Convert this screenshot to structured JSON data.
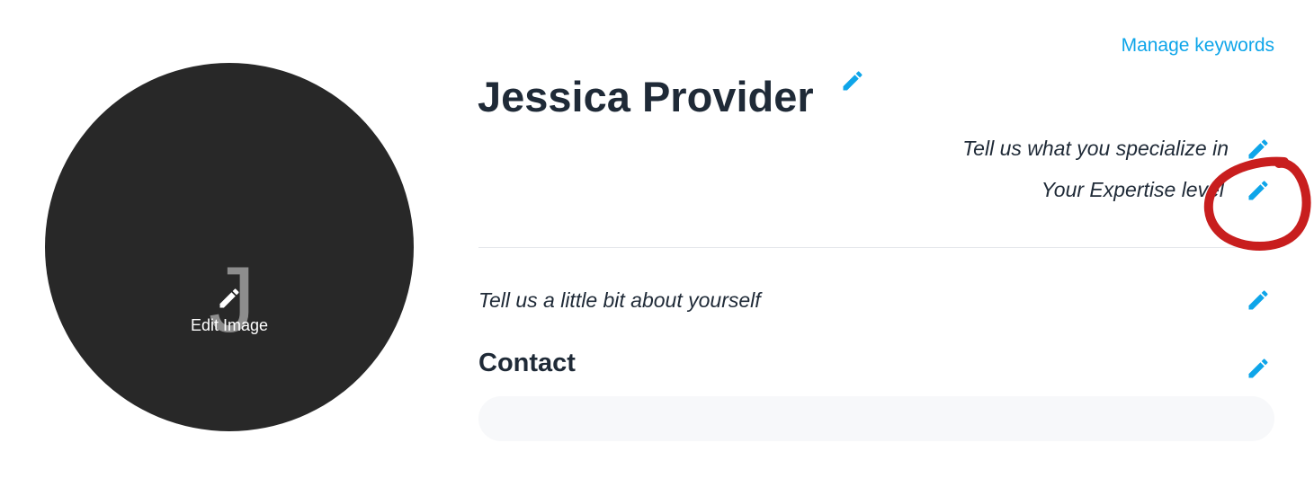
{
  "avatar": {
    "initial": "J",
    "edit_label": "Edit Image"
  },
  "header": {
    "manage_keywords": "Manage keywords",
    "name": "Jessica Provider"
  },
  "fields": {
    "specialize_placeholder": "Tell us what you specialize in",
    "expertise_placeholder": "Your Expertise level",
    "about_placeholder": "Tell us a little bit about yourself"
  },
  "contact": {
    "title": "Contact"
  },
  "colors": {
    "accent": "#0ea5e9",
    "text": "#1f2a37",
    "avatar_bg": "#282828",
    "annotation": "#c81e1e"
  },
  "icons": {
    "edit": "pencil-icon"
  }
}
